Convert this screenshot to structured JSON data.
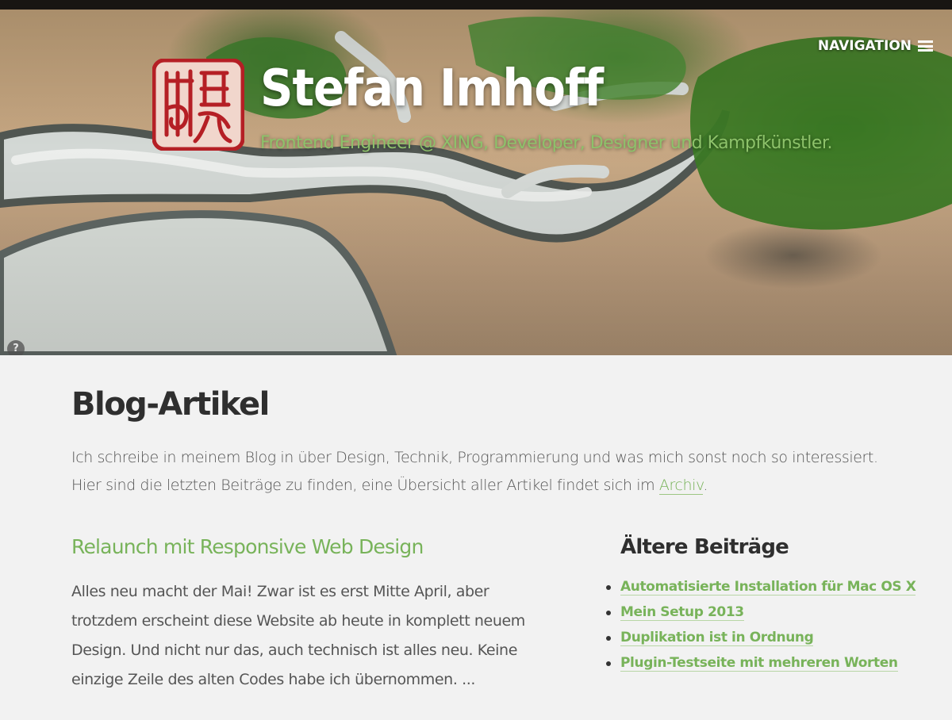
{
  "header": {
    "title": "Stefan Imhoff",
    "subtitle": "Frontend Engineer @ XING, Developer, Designer und Kampfkünstler.",
    "nav_label": "NAVIGATION",
    "help_label": "?"
  },
  "main": {
    "heading": "Blog-Artikel",
    "intro_text": "Ich schreibe in meinem Blog in über Design, Technik, Programmierung und was mich sonst noch so interessiert. Hier sind die letzten Beiträge zu finden, eine Übersicht aller Artikel findet sich im ",
    "intro_link": "Archiv",
    "intro_end": ".",
    "featured_post": {
      "title": "Relaunch mit Responsive Web Design",
      "excerpt": "Alles neu macht der Mai! Zwar ist es erst Mitte April, aber trotzdem erscheint diese Website ab heute in komplett neuem Design. Und nicht nur das, auch technisch ist alles neu. Keine einzige Zeile des alten Codes habe ich übernommen. ..."
    },
    "older_posts": {
      "heading": "Ältere Beiträge",
      "items": [
        "Automatisierte Installation für Mac OS X",
        "Mein Setup 2013",
        "Duplikation ist in Ordnung",
        "Plugin-Testseite mit mehreren Worten"
      ]
    }
  },
  "colors": {
    "accent": "#78b35a",
    "title_text": "#ffffff",
    "seal": "#b51f25",
    "topbar": "#181512"
  },
  "icons": {
    "logo": "red-seal-logo",
    "nav": "hamburger-icon",
    "help": "question-icon"
  }
}
